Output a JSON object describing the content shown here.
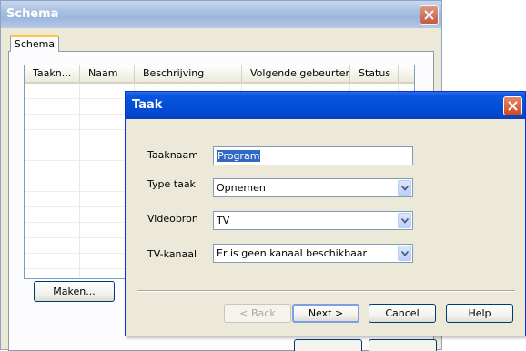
{
  "background_window": {
    "title": "Schema",
    "tab_label": "Schema",
    "columns": [
      "Taakn...",
      "Naam",
      "Beschrijving",
      "Volgende gebeurtenis",
      "Status"
    ],
    "make_button": "Maken..."
  },
  "dialog": {
    "title": "Taak",
    "fields": {
      "task_name": {
        "label": "Taaknaam",
        "value": "Program"
      },
      "task_type": {
        "label": "Type taak",
        "value": "Opnemen"
      },
      "video_source": {
        "label": "Videobron",
        "value": "TV"
      },
      "tv_channel": {
        "label": "TV-kanaal",
        "value": "Er is geen kanaal beschikbaar"
      }
    },
    "buttons": {
      "back": "< Back",
      "next": "Next >",
      "cancel": "Cancel",
      "help": "Help"
    }
  },
  "icons": {
    "close": "close-icon",
    "dropdown": "chevron-down-icon"
  },
  "colors": {
    "active_titlebar": "#0350d8",
    "inactive_titlebar": "#a9bfe2",
    "selection": "#316ac5",
    "tab_highlight": "#ffc83c"
  }
}
